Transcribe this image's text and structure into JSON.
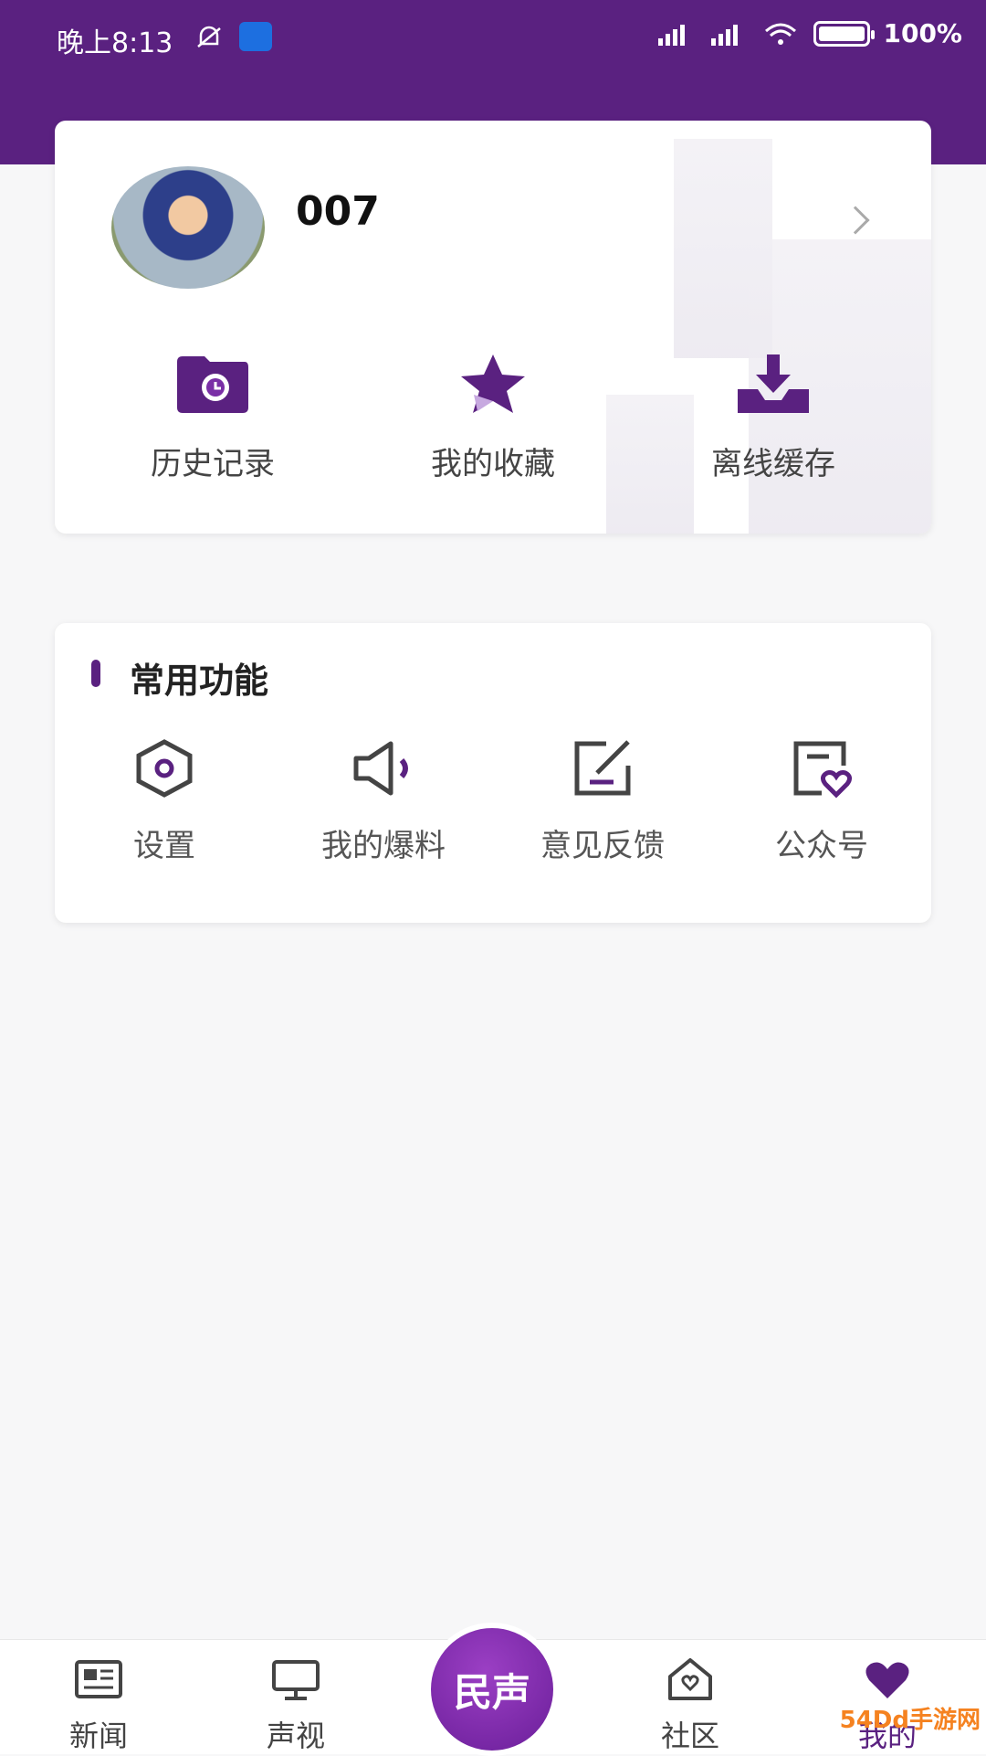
{
  "status_bar": {
    "time": "晚上8:13",
    "battery": "100%"
  },
  "profile": {
    "username": "007"
  },
  "quick_actions": [
    {
      "label": "历史记录",
      "icon": "history-folder-icon"
    },
    {
      "label": "我的收藏",
      "icon": "star-icon"
    },
    {
      "label": "离线缓存",
      "icon": "download-icon"
    }
  ],
  "functions": {
    "title": "常用功能",
    "items": [
      {
        "label": "设置",
        "icon": "settings-hexagon-icon"
      },
      {
        "label": "我的爆料",
        "icon": "speaker-icon"
      },
      {
        "label": "意见反馈",
        "icon": "feedback-edit-icon"
      },
      {
        "label": "公众号",
        "icon": "public-account-heart-icon"
      }
    ]
  },
  "tabbar": {
    "tabs": [
      {
        "label": "新闻",
        "icon": "news-icon"
      },
      {
        "label": "声视",
        "icon": "monitor-icon"
      },
      {
        "label": "社区",
        "icon": "community-home-icon"
      },
      {
        "label": "我的",
        "icon": "heart-icon"
      }
    ],
    "center_label": "民声"
  },
  "watermark": "54Dd手游网",
  "colors": {
    "brand": "#5a2180",
    "accent": "#7a2fa6"
  }
}
